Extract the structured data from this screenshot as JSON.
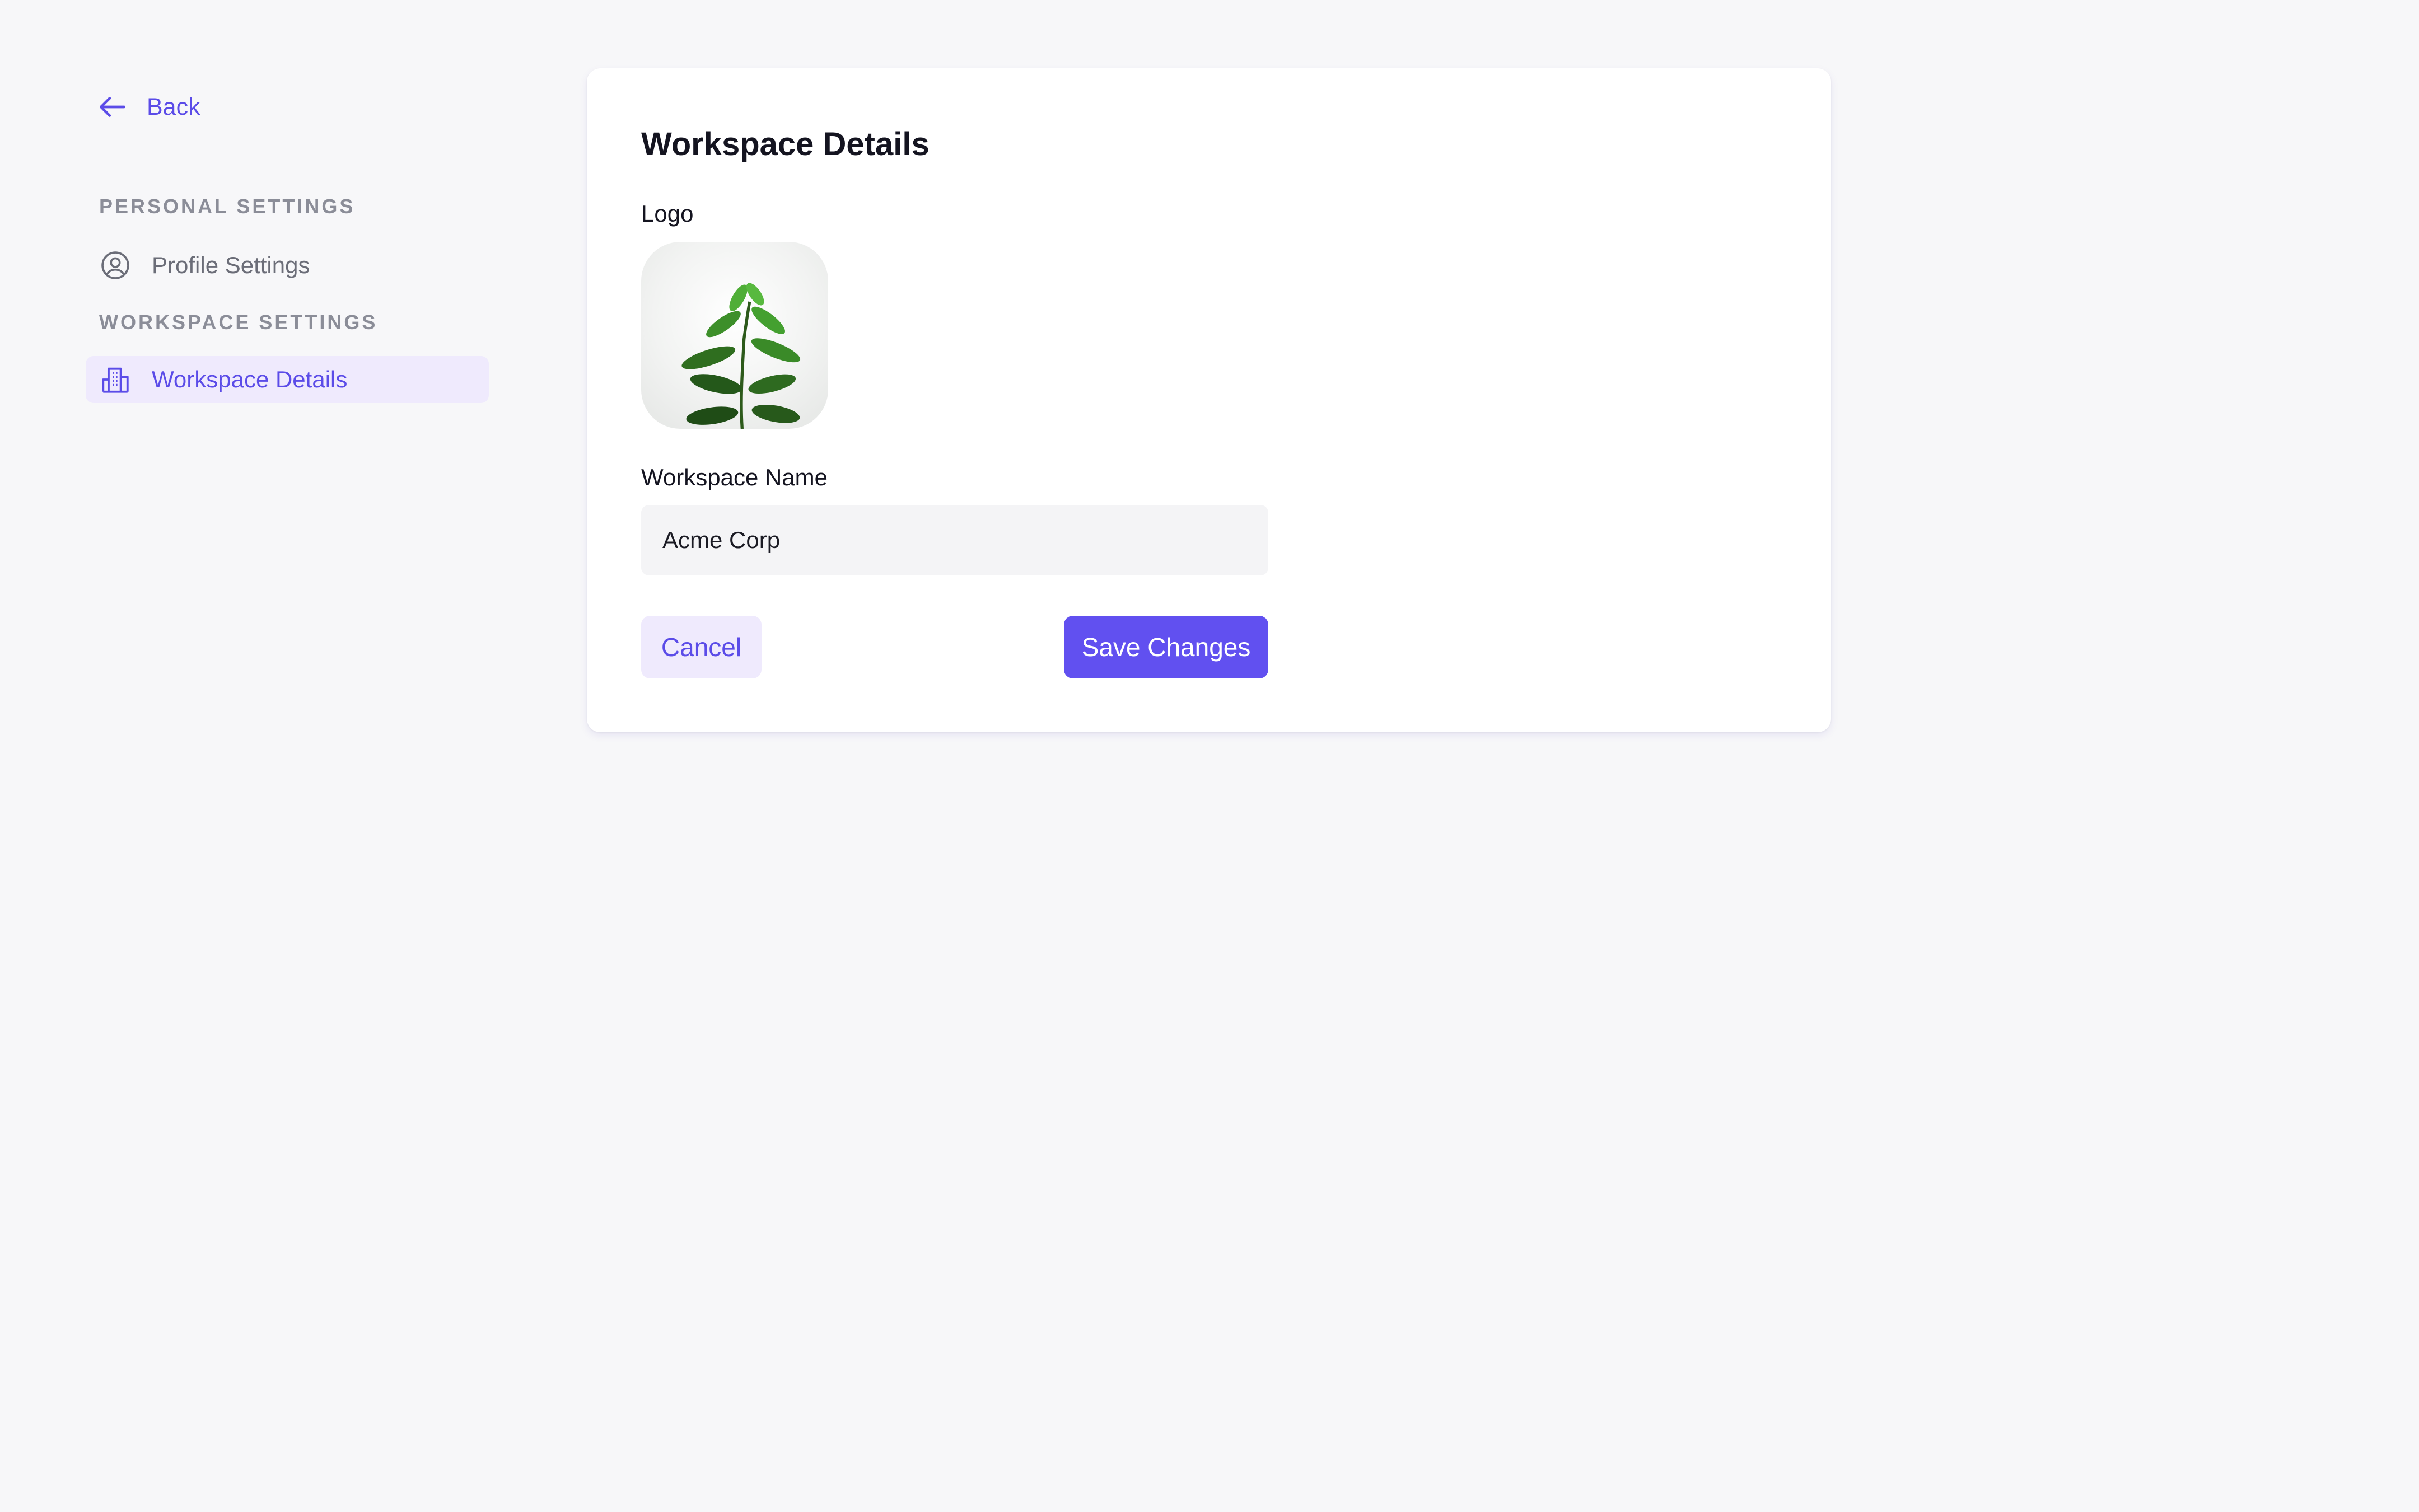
{
  "sidebar": {
    "back_label": "Back",
    "personal_section": "PERSONAL SETTINGS",
    "profile_item": "Profile Settings",
    "workspace_section": "WORKSPACE SETTINGS",
    "workspace_item": "Workspace Details",
    "active_item": "Workspace Details"
  },
  "main": {
    "title": "Workspace Details",
    "logo_label": "Logo",
    "logo_image": "plant-photo",
    "name_label": "Workspace Name",
    "name_value": "Acme Corp",
    "cancel_label": "Cancel",
    "save_label": "Save Changes"
  },
  "icons": {
    "back": "arrow-left-icon",
    "profile": "user-circle-icon",
    "workspace": "building-icon"
  },
  "colors": {
    "accent": "#5b4ce8",
    "primary_button": "#6150f0",
    "active_bg": "#efeafd",
    "page_bg": "#f7f7f9",
    "muted_text": "#8b8d98"
  }
}
